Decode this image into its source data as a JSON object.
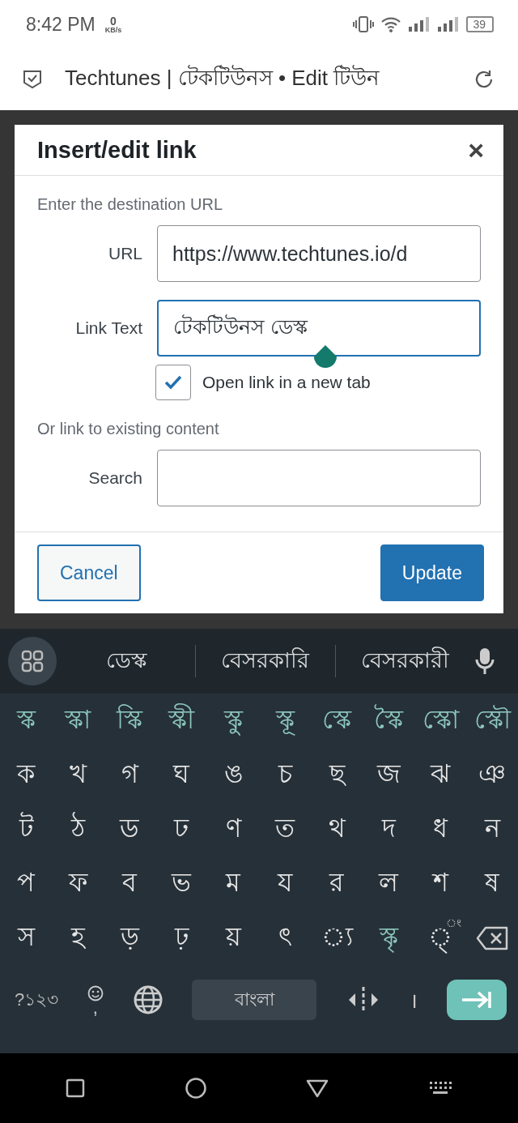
{
  "status_bar": {
    "time": "8:42 PM",
    "speed_value": "0",
    "speed_unit": "KB/s",
    "battery": "39"
  },
  "browser": {
    "title": "Techtunes | টেকটিউনস • Edit টিউন"
  },
  "dialog": {
    "title": "Insert/edit link",
    "close": "×",
    "intro": "Enter the destination URL",
    "fields": [
      {
        "label": "URL",
        "value": "https://www.techtunes.io/d",
        "focused": false
      },
      {
        "label": "Link Text",
        "value": "টেকটিউনস ডেস্ক",
        "focused": true
      }
    ],
    "new_tab": {
      "label": "Open link in a new tab",
      "checked": true
    },
    "existing": "Or link to existing content",
    "search": {
      "label": "Search"
    },
    "buttons": [
      {
        "label": "Cancel",
        "kind": "secondary"
      },
      {
        "label": "Update",
        "kind": "primary"
      }
    ]
  },
  "keyboard": {
    "suggestions": [
      "ডেস্ক",
      "বেসরকারি",
      "বেসরকারী"
    ],
    "rows": [
      [
        {
          "label": "স্ক",
          "kind": "conjunct"
        },
        {
          "label": "স্কা",
          "kind": "conjunct"
        },
        {
          "label": "স্কি",
          "kind": "conjunct"
        },
        {
          "label": "স্কী",
          "kind": "conjunct"
        },
        {
          "label": "স্কু",
          "kind": "conjunct"
        },
        {
          "label": "স্কূ",
          "kind": "conjunct"
        },
        {
          "label": "স্কে",
          "kind": "conjunct"
        },
        {
          "label": "স্কৈ",
          "kind": "conjunct"
        },
        {
          "label": "স্কো",
          "kind": "conjunct"
        },
        {
          "label": "স্কৌ",
          "kind": "conjunct"
        }
      ],
      [
        {
          "label": "ক",
          "kind": "letter"
        },
        {
          "label": "খ",
          "kind": "letter"
        },
        {
          "label": "গ",
          "kind": "letter"
        },
        {
          "label": "ঘ",
          "kind": "letter"
        },
        {
          "label": "ঙ",
          "kind": "letter"
        },
        {
          "label": "চ",
          "kind": "letter"
        },
        {
          "label": "ছ",
          "kind": "letter"
        },
        {
          "label": "জ",
          "kind": "letter"
        },
        {
          "label": "ঝ",
          "kind": "letter"
        },
        {
          "label": "ঞ",
          "kind": "letter"
        }
      ],
      [
        {
          "label": "ট",
          "kind": "letter"
        },
        {
          "label": "ঠ",
          "kind": "letter"
        },
        {
          "label": "ড",
          "kind": "letter"
        },
        {
          "label": "ঢ",
          "kind": "letter"
        },
        {
          "label": "ণ",
          "kind": "letter"
        },
        {
          "label": "ত",
          "kind": "letter"
        },
        {
          "label": "থ",
          "kind": "letter"
        },
        {
          "label": "দ",
          "kind": "letter"
        },
        {
          "label": "ধ",
          "kind": "letter"
        },
        {
          "label": "ন",
          "kind": "letter"
        }
      ],
      [
        {
          "label": "প",
          "kind": "letter"
        },
        {
          "label": "ফ",
          "kind": "letter"
        },
        {
          "label": "ব",
          "kind": "letter"
        },
        {
          "label": "ভ",
          "kind": "letter"
        },
        {
          "label": "ম",
          "kind": "letter"
        },
        {
          "label": "য",
          "kind": "letter"
        },
        {
          "label": "র",
          "kind": "letter"
        },
        {
          "label": "ল",
          "kind": "letter"
        },
        {
          "label": "শ",
          "kind": "letter"
        },
        {
          "label": "ষ",
          "kind": "letter"
        }
      ],
      [
        {
          "label": "স",
          "kind": "letter"
        },
        {
          "label": "হ",
          "kind": "letter"
        },
        {
          "label": "ড়",
          "kind": "letter"
        },
        {
          "label": "ঢ়",
          "kind": "letter"
        },
        {
          "label": "য়",
          "kind": "letter"
        },
        {
          "label": "ৎ",
          "kind": "letter"
        },
        {
          "label": "◌্য",
          "kind": "letter"
        },
        {
          "label": "স্কৃ",
          "kind": "conjunct"
        },
        {
          "label": "◌্",
          "hint": "◌ং",
          "kind": "letter"
        },
        {
          "kind": "backspace"
        }
      ]
    ],
    "bottom": {
      "symbols": "?১২৩",
      "comma": ",",
      "space": "বাংলা",
      "danda": "।"
    }
  }
}
